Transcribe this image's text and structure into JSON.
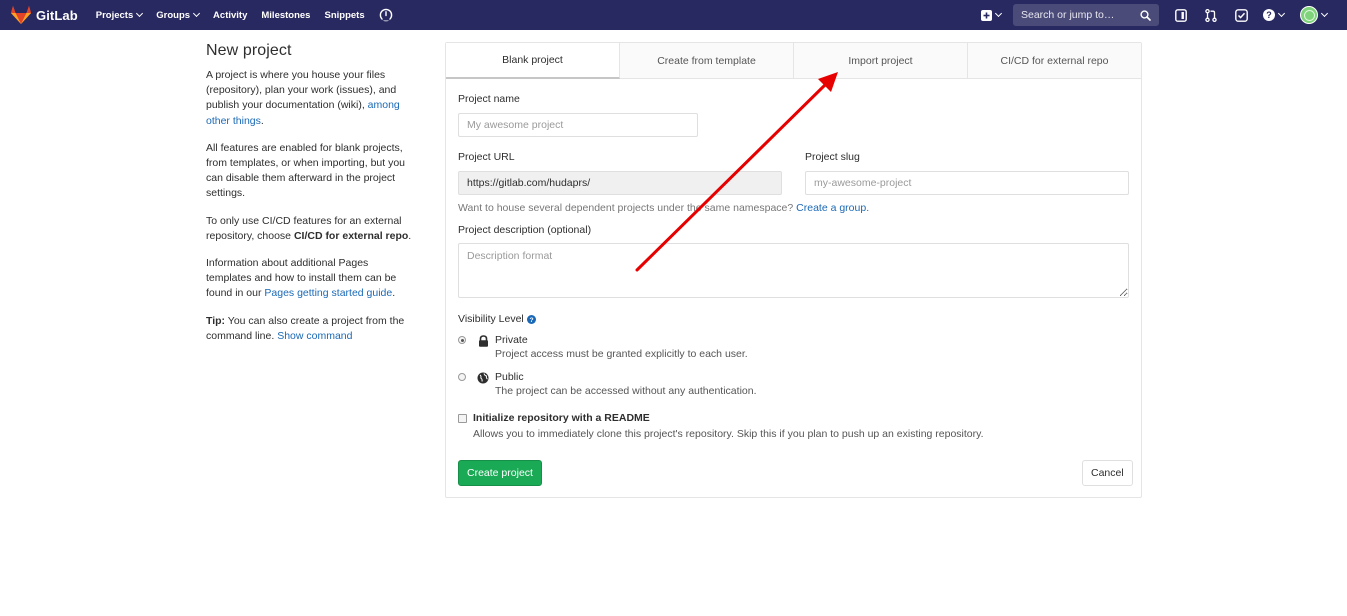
{
  "navbar": {
    "brand": "GitLab",
    "links": [
      {
        "label": "Projects",
        "dropdown": true
      },
      {
        "label": "Groups",
        "dropdown": true
      },
      {
        "label": "Activity",
        "dropdown": false
      },
      {
        "label": "Milestones",
        "dropdown": false
      },
      {
        "label": "Snippets",
        "dropdown": false
      }
    ],
    "search_placeholder": "Search or jump to…",
    "bg_color": "#292961"
  },
  "sidebar": {
    "title": "New project",
    "p1_text": "A project is where you house your files (repository), plan your work (issues), and publish your documentation (wiki), ",
    "p1_link": "among other things",
    "p1_end": ".",
    "p2_text": "All features are enabled for blank projects, from templates, or when importing, but you can disable them afterward in the project settings.",
    "p3_text": "To only use CI/CD features for an external repository, choose ",
    "p3_bold": "CI/CD for external repo",
    "p3_end": ".",
    "p4_text": "Information about additional Pages templates and how to install them can be found in our ",
    "p4_link": "Pages getting started guide",
    "p4_end": ".",
    "tip_label": "Tip:",
    "tip_text": " You can also create a project from the command line. ",
    "tip_link": "Show command"
  },
  "tabs": [
    {
      "label": "Blank project",
      "active": true
    },
    {
      "label": "Create from template",
      "active": false
    },
    {
      "label": "Import project",
      "active": false
    },
    {
      "label": "CI/CD for external repo",
      "active": false
    }
  ],
  "form": {
    "project_name_label": "Project name",
    "project_name_placeholder": "My awesome project",
    "project_url_label": "Project URL",
    "project_url_value": "https://gitlab.com/hudaprs/",
    "project_slug_label": "Project slug",
    "project_slug_placeholder": "my-awesome-project",
    "namespace_help": "Want to house several dependent projects under the same namespace? ",
    "namespace_link": "Create a group.",
    "description_label": "Project description (optional)",
    "description_placeholder": "Description format",
    "visibility_label": "Visibility Level",
    "visibility_options": [
      {
        "title": "Private",
        "desc": "Project access must be granted explicitly to each user.",
        "checked": true,
        "icon": "lock-icon"
      },
      {
        "title": "Public",
        "desc": "The project can be accessed without any authentication.",
        "checked": false,
        "icon": "globe-icon"
      }
    ],
    "readme_label": "Initialize repository with a README",
    "readme_desc": "Allows you to immediately clone this project's repository. Skip this if you plan to push up an existing repository.",
    "create_button": "Create project",
    "cancel_button": "Cancel"
  },
  "colors": {
    "link": "#1b69b6",
    "primary_button": "#1aaa55",
    "annotation_arrow": "#e60000"
  }
}
